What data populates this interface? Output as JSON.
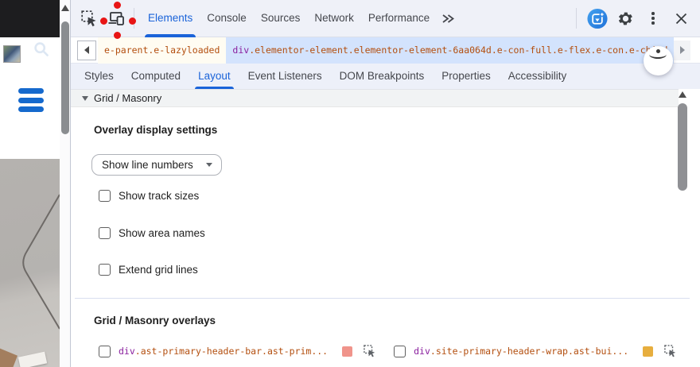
{
  "toolbar": {
    "tabs": [
      {
        "label": "Elements",
        "active": true
      },
      {
        "label": "Console",
        "active": false
      },
      {
        "label": "Sources",
        "active": false
      },
      {
        "label": "Network",
        "active": false
      },
      {
        "label": "Performance",
        "active": false
      }
    ],
    "accent_color": "#1a63d9"
  },
  "breadcrumb": {
    "crumb_prev": "e-parent.e-lazyloaded",
    "selected": {
      "tag": "div",
      "classes": ".elementor-element.elementor-element-6aa064d.e-con-full.e-flex.e-con.e-child"
    }
  },
  "panel_tabs": [
    {
      "label": "Styles",
      "active": false
    },
    {
      "label": "Computed",
      "active": false
    },
    {
      "label": "Layout",
      "active": true
    },
    {
      "label": "Event Listeners",
      "active": false
    },
    {
      "label": "DOM Breakpoints",
      "active": false
    },
    {
      "label": "Properties",
      "active": false
    },
    {
      "label": "Accessibility",
      "active": false
    }
  ],
  "layout_pane": {
    "section_title": "Grid / Masonry",
    "overlay_settings": {
      "title": "Overlay display settings",
      "dropdown_value": "Show line numbers",
      "checkboxes": [
        {
          "label": "Show track sizes",
          "checked": false
        },
        {
          "label": "Show area names",
          "checked": false
        },
        {
          "label": "Extend grid lines",
          "checked": false
        }
      ]
    },
    "overlays": {
      "title": "Grid / Masonry overlays",
      "items": [
        {
          "tag": "div",
          "classes": ".ast-primary-header-bar.ast-prim...",
          "color": "#f0948b",
          "checked": false
        },
        {
          "tag": "div",
          "classes": ".site-primary-header-wrap.ast-bui...",
          "color": "#e7ae3e",
          "checked": false
        }
      ]
    }
  },
  "colors": {
    "selected_crumb_bg": "#d3e3fd",
    "selector_tag": "#8a1f9e",
    "selector_classes": "#b34e0e",
    "annotation_red": "#e81515",
    "hamburger_blue": "#1569cd"
  }
}
